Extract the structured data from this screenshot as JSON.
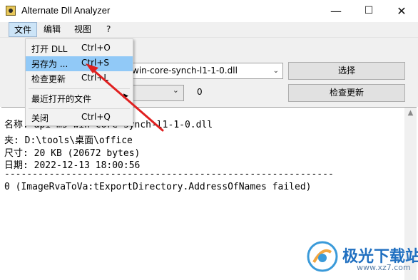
{
  "window": {
    "title": "Alternate Dll Analyzer",
    "minimize": "—",
    "maximize": "☐",
    "close": "✕"
  },
  "menubar": {
    "file": "文件",
    "edit": "编辑",
    "view": "视图",
    "help": "?"
  },
  "file_menu": {
    "items": [
      {
        "label": "打开 DLL",
        "shortcut": "Ctrl+O"
      },
      {
        "label": "另存为 ...",
        "shortcut": "Ctrl+S"
      },
      {
        "label": "检查更新",
        "shortcut": "Ctrl+L"
      },
      {
        "label": "最近打开的文件",
        "shortcut": ""
      },
      {
        "label": "关闭",
        "shortcut": "Ctrl+Q"
      }
    ]
  },
  "toolbar": {
    "dll_value": "win-core-synch-l1-1-0.dll",
    "select_button": "选择",
    "count_value": "0",
    "check_update_button": "检查更新"
  },
  "output": {
    "lines": [
      "名称: api-ms-win-core-synch-l1-1-0.dll",
      "夹: D:\\tools\\桌面\\office",
      "尺寸: 20 KB (20672 bytes)",
      "日期: 2022-12-13 18:00:56",
      "-----------------------------------------------------------",
      "0 (ImageRvaToVa:tExportDirectory.AddressOfNames failed)"
    ]
  },
  "watermark": {
    "brand": "极光下载站",
    "url": "www.xz7.com"
  },
  "colors": {
    "menu_highlight": "#91c9f7",
    "arrow": "#e02020",
    "watermark": "#1f6fc0"
  }
}
